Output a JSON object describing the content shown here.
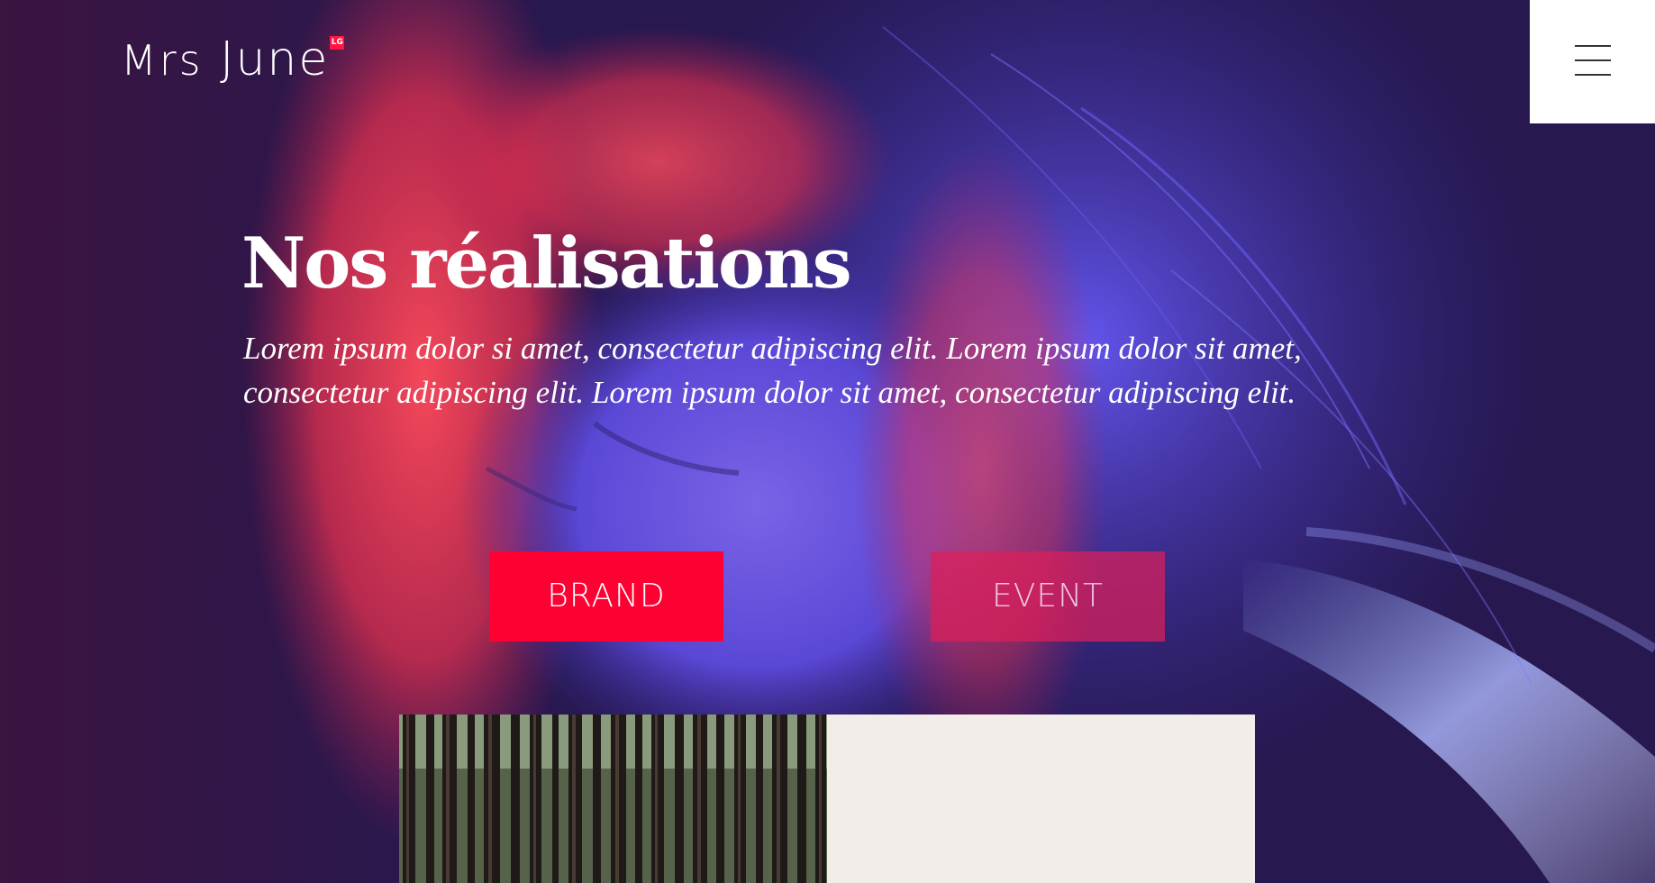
{
  "brand": {
    "logo_prefix": "Mrs",
    "logo_name": "June",
    "logo_badge": "LG"
  },
  "header": {
    "menu_icon": "hamburger-menu-icon"
  },
  "hero": {
    "title": "Nos réalisations",
    "lead": "Lorem ipsum dolor si amet, consectetur adipiscing elit. Lorem ipsum dolor sit amet, consectetur adipiscing elit. Lorem ipsum dolor sit amet, consectetur adipiscing elit."
  },
  "categories": [
    {
      "label": "BRAND",
      "active": true
    },
    {
      "label": "EVENT",
      "active": false
    }
  ],
  "colors": {
    "accent": "#ff0033",
    "inactive_button": "#dc1e5a",
    "menu_bg": "#ffffff",
    "card_bg": "#f3ede9",
    "hero_base": "#2a1b52"
  }
}
